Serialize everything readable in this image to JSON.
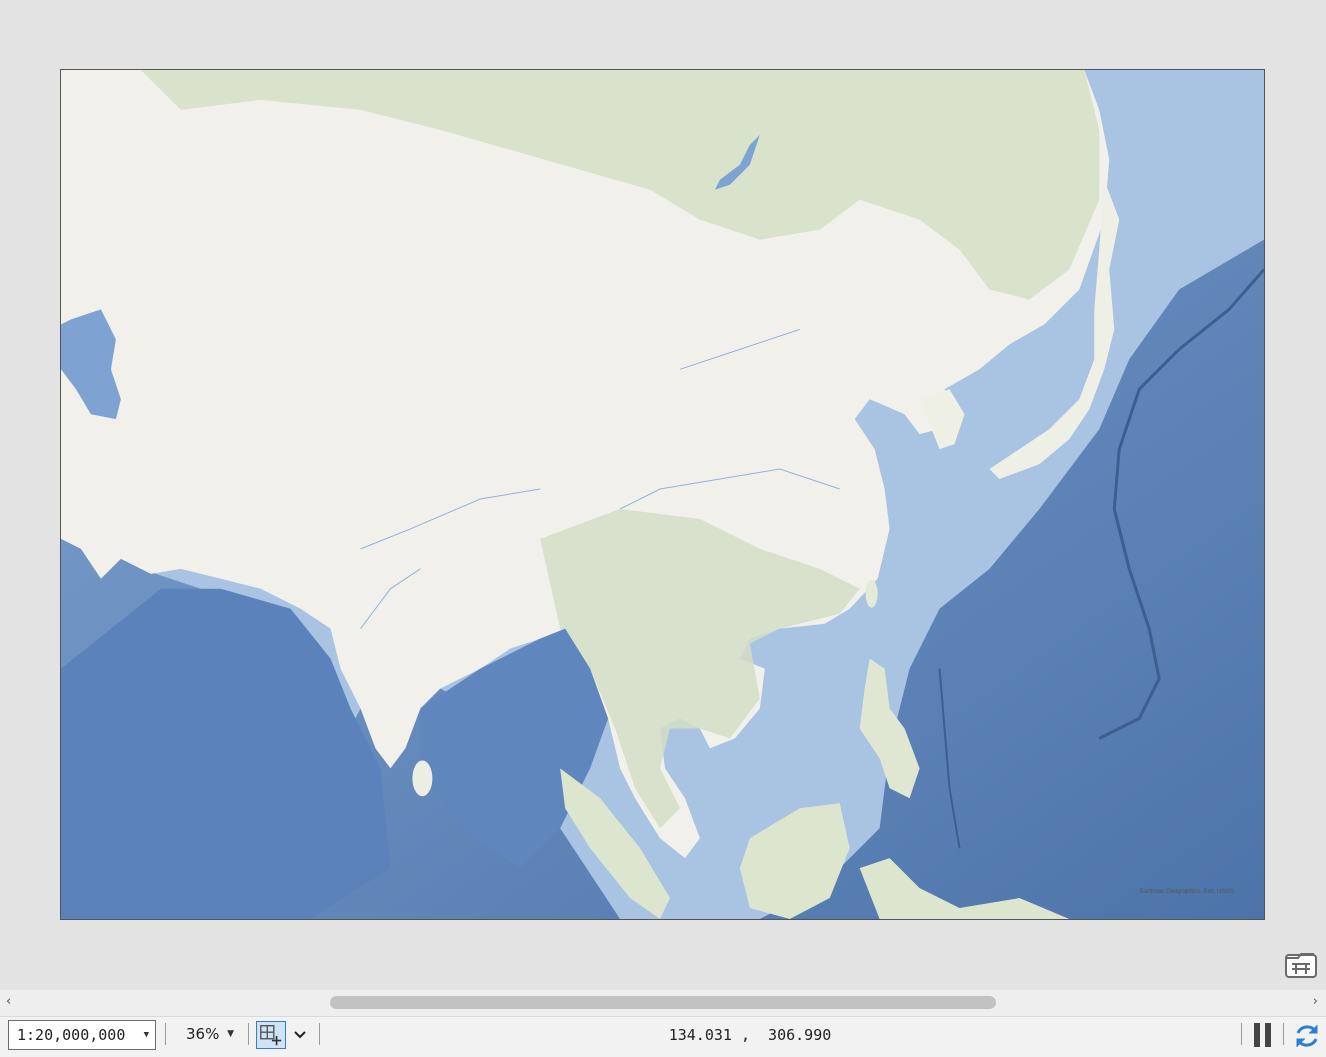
{
  "map": {
    "attribution": "Earthstar Geographics, Esri, USGS"
  },
  "scrollbar": {
    "left_arrow": "‹",
    "right_arrow": "›"
  },
  "statusbar": {
    "scale": "1:20,000,000",
    "zoom": "36%",
    "snap_dropdown_icon": "chevron-down-icon",
    "coordinates": "134.031 ,  306.990",
    "pause_icon": "pause-icon",
    "refresh_icon": "refresh-icon"
  },
  "colors": {
    "ocean_deep": "#4f77ad",
    "ocean": "#6e93c4",
    "shelf": "#a6c2e2",
    "land": "#f0efea",
    "vegetation": "#d4dfc6",
    "accent": "#2a7fd4"
  }
}
